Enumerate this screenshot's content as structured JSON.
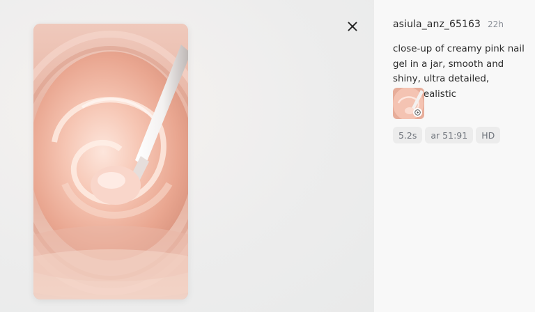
{
  "post": {
    "username": "asiula_anz_65163",
    "time": "22h",
    "prompt": "close-up of creamy pink nail gel in a jar, smooth and shiny, ultra detailed, photorealistic",
    "tags": [
      "5.2s",
      "ar 51:91",
      "HD"
    ]
  },
  "icons": {
    "close": "close-icon",
    "play": "play-icon"
  },
  "colors": {
    "panel_bg": "#f8f8f8",
    "tag_bg": "#ececec",
    "cream": "#f1b9a6"
  }
}
